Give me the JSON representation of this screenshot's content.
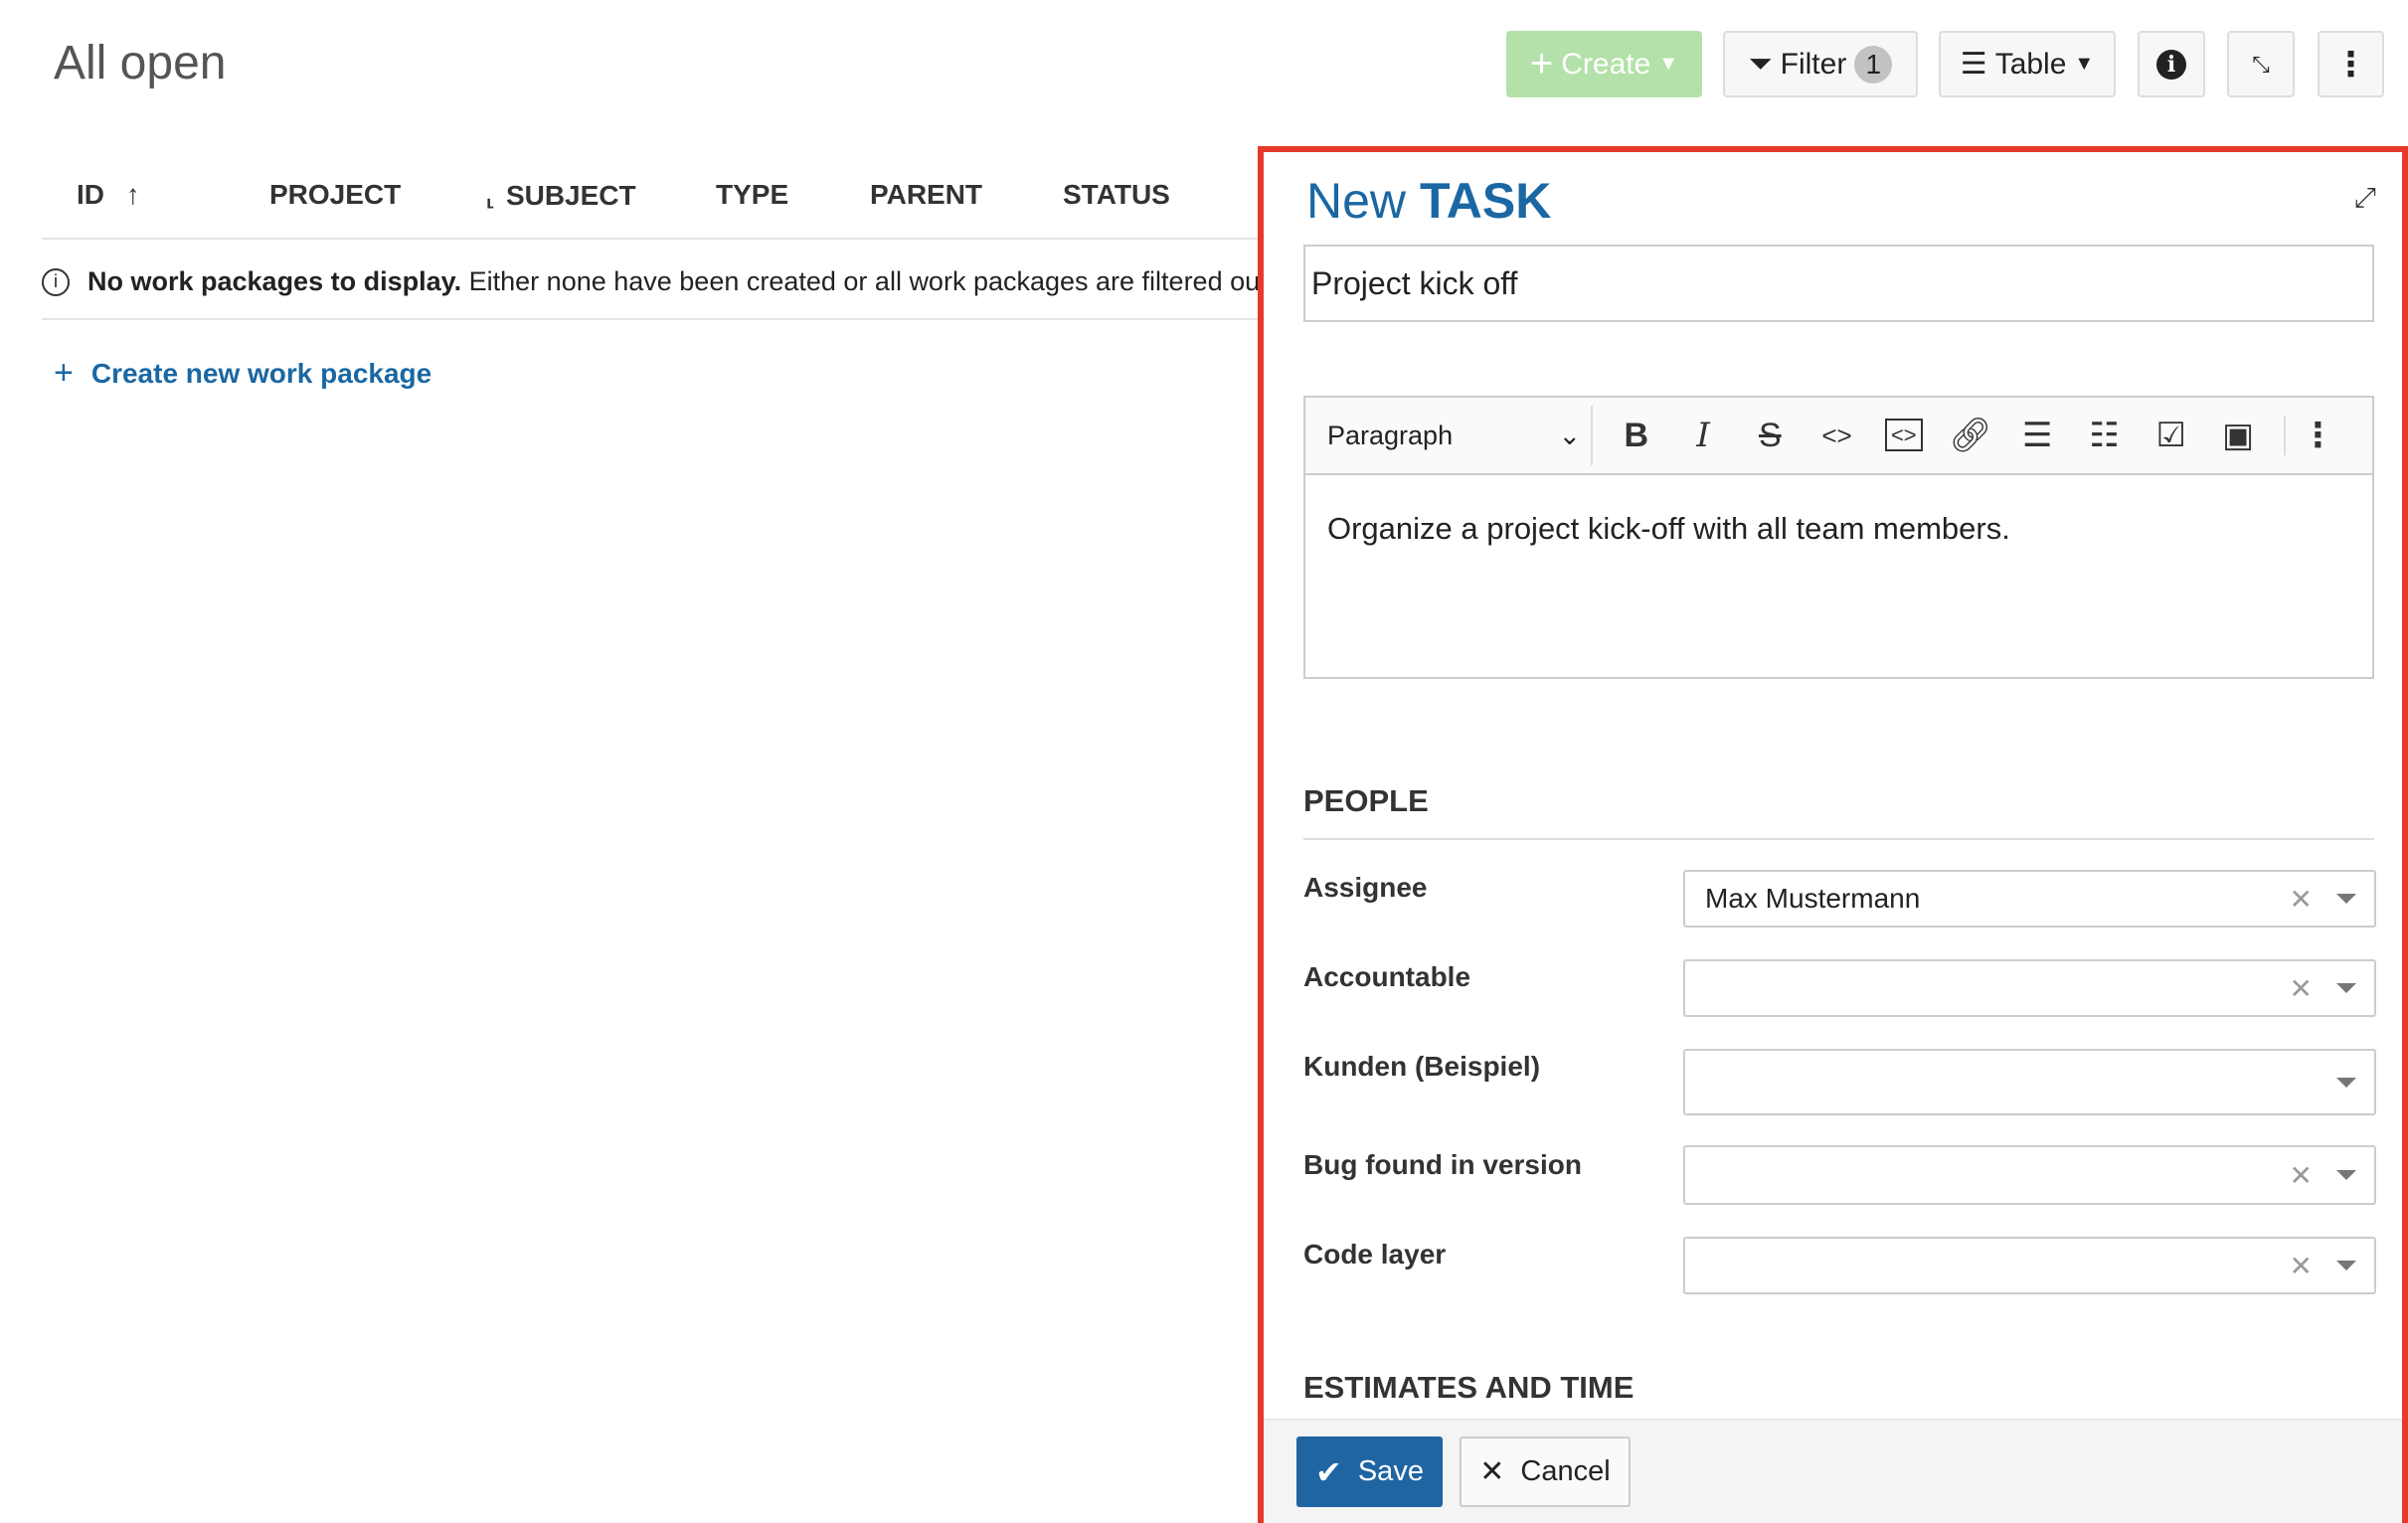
{
  "header": {
    "title": "All open",
    "create": "Create",
    "filter": "Filter",
    "filter_count": "1",
    "table": "Table"
  },
  "table": {
    "columns": [
      "ID",
      "PROJECT",
      "SUBJECT",
      "TYPE",
      "PARENT",
      "STATUS"
    ],
    "empty_bold": "No work packages to display.",
    "empty_text": "Either none have been created or all work packages are filtered ou",
    "create_link": "Create new work package"
  },
  "panel": {
    "title_new": "New",
    "title_type": "TASK",
    "subject": "Project kick off",
    "editor": {
      "block_style": "Paragraph",
      "content": "Organize a project kick-off with all team members."
    },
    "people_section": "PEOPLE",
    "fields": [
      {
        "label": "Assignee",
        "value": "Max Mustermann"
      },
      {
        "label": "Accountable",
        "value": ""
      },
      {
        "label": "Kunden (Beispiel)",
        "value": ""
      },
      {
        "label": "Bug found in version",
        "value": ""
      },
      {
        "label": "Code layer",
        "value": ""
      }
    ],
    "estimates_section": "ESTIMATES AND TIME",
    "save": "Save",
    "cancel": "Cancel"
  },
  "colors": {
    "accent": "#1a67a3",
    "highlight": "#e53a2b",
    "create": "#b3e1a9"
  }
}
